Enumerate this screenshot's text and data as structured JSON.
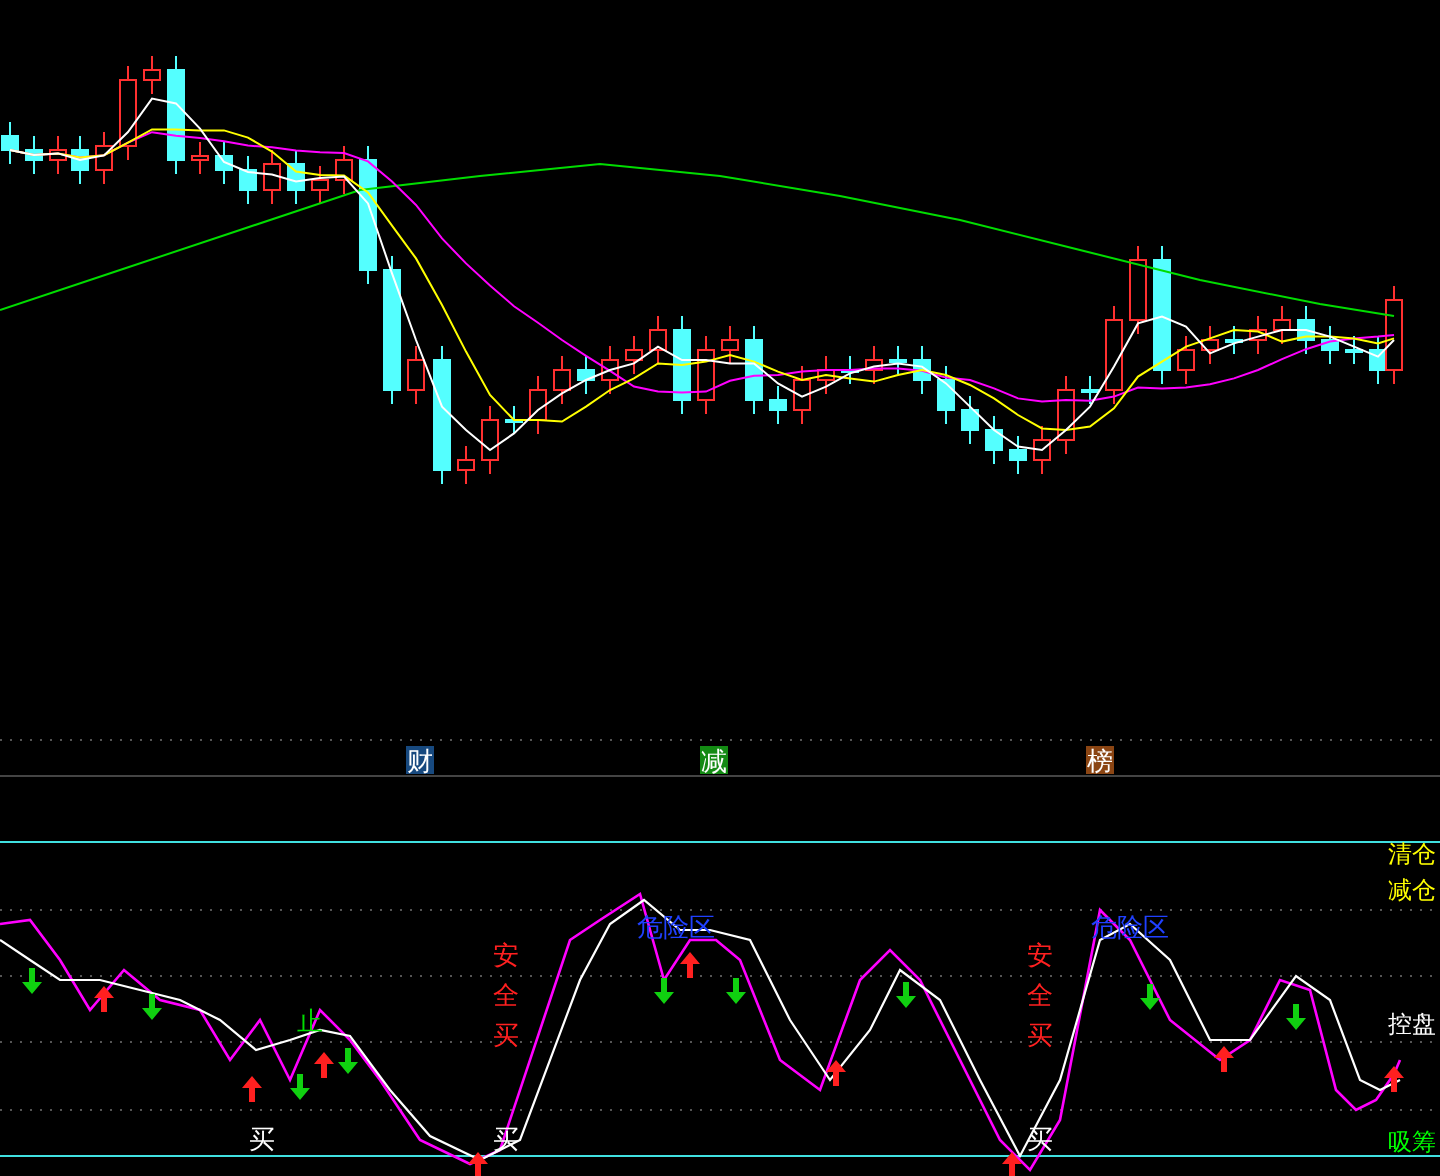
{
  "indicator_badges": [
    {
      "label": "财",
      "color": "#17497f"
    },
    {
      "label": "减",
      "color": "#138a13"
    },
    {
      "label": "榜",
      "color": "#8b4513"
    }
  ],
  "oscillator": {
    "zone_labels": [
      {
        "label": "清仓",
        "kind": "clear"
      },
      {
        "label": "减仓",
        "kind": "reduce"
      },
      {
        "label": "控盘",
        "kind": "control"
      },
      {
        "label": "吸筹",
        "kind": "accumulate"
      }
    ],
    "signals": [
      {
        "label": "买",
        "kind": "buy"
      },
      {
        "label": "止",
        "kind": "stop"
      },
      {
        "label": "安全买",
        "kind": "safe-buy"
      },
      {
        "label": "买",
        "kind": "buy"
      },
      {
        "label": "危险区",
        "kind": "danger"
      },
      {
        "label": "安全买",
        "kind": "safe-buy"
      },
      {
        "label": "买",
        "kind": "buy"
      },
      {
        "label": "危险区",
        "kind": "danger"
      }
    ]
  }
}
